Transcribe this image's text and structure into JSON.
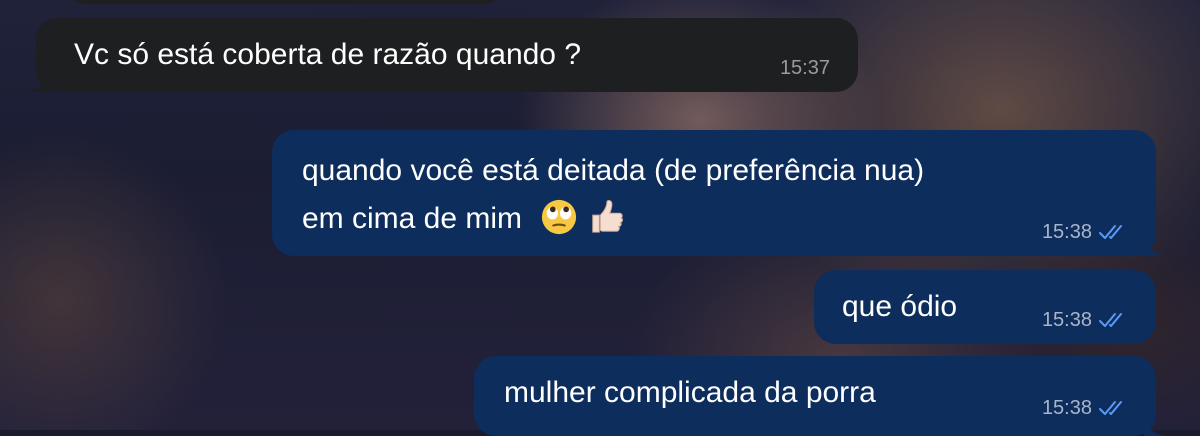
{
  "messages": [
    {
      "direction": "incoming",
      "text": "Vc só está coberta de razão quando ?",
      "time": "15:37"
    },
    {
      "direction": "outgoing",
      "text_line1": "quando você está deitada (de preferência nua)",
      "text_line2": "em cima de mim",
      "emoji_1": "face-with-rolling-eyes",
      "emoji_2": "thumbs-up-light-skin-tone",
      "time": "15:38",
      "status": "read"
    },
    {
      "direction": "outgoing",
      "text": "que ódio",
      "time": "15:38",
      "status": "read"
    },
    {
      "direction": "outgoing",
      "text": "mulher complicada da porra",
      "time": "15:38",
      "status": "read"
    }
  ],
  "colors": {
    "incoming_bubble": "#1e1f21",
    "outgoing_bubble": "#0d2d5c",
    "read_check": "#5b9bf5"
  },
  "icons": {
    "read_receipt": "double-check-icon"
  }
}
